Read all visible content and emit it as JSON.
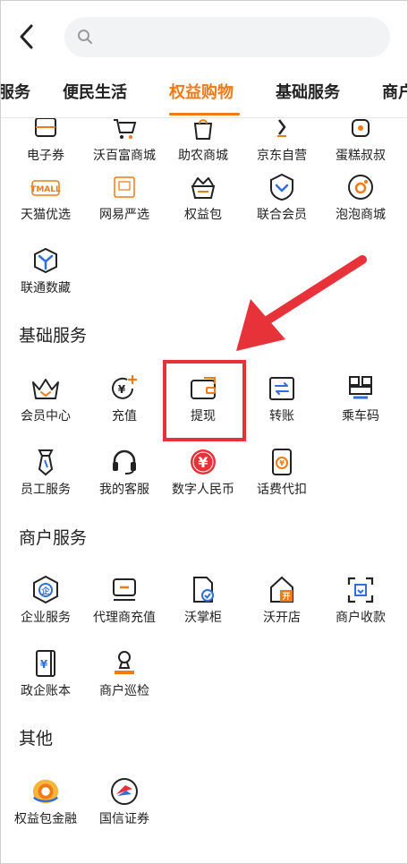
{
  "tabs": [
    {
      "label": "服务"
    },
    {
      "label": "便民生活"
    },
    {
      "label": "权益购物"
    },
    {
      "label": "基础服务"
    },
    {
      "label": "商户"
    }
  ],
  "search": {
    "placeholder": ""
  },
  "shopping": {
    "items": [
      {
        "label": "电子券",
        "icon": "coupon-icon"
      },
      {
        "label": "沃百富商城",
        "icon": "cart-icon"
      },
      {
        "label": "助农商城",
        "icon": "farm-bag-icon"
      },
      {
        "label": "京东自营",
        "icon": "jd-icon"
      },
      {
        "label": "蛋糕叔叔",
        "icon": "cake-icon"
      },
      {
        "label": "天猫优选",
        "icon": "tmall-icon"
      },
      {
        "label": "网易严选",
        "icon": "netease-icon"
      },
      {
        "label": "权益包",
        "icon": "crown-basket-icon"
      },
      {
        "label": "联合会员",
        "icon": "shield-chevron-icon"
      },
      {
        "label": "泡泡商城",
        "icon": "bubble-icon"
      },
      {
        "label": "联通数藏",
        "icon": "cube-icon"
      }
    ]
  },
  "basic": {
    "title": "基础服务",
    "items": [
      {
        "label": "会员中心",
        "icon": "crown-icon"
      },
      {
        "label": "充值",
        "icon": "recharge-icon"
      },
      {
        "label": "提现",
        "icon": "wallet-icon"
      },
      {
        "label": "转账",
        "icon": "transfer-icon"
      },
      {
        "label": "乘车码",
        "icon": "bus-code-icon"
      },
      {
        "label": "员工服务",
        "icon": "tie-icon"
      },
      {
        "label": "我的客服",
        "icon": "headset-icon"
      },
      {
        "label": "数字人民币",
        "icon": "ecny-icon"
      },
      {
        "label": "话费代扣",
        "icon": "phone-bill-icon"
      }
    ]
  },
  "merchant": {
    "title": "商户服务",
    "items": [
      {
        "label": "企业服务",
        "icon": "enterprise-icon"
      },
      {
        "label": "代理商充值",
        "icon": "agent-recharge-icon"
      },
      {
        "label": "沃掌柜",
        "icon": "manager-icon"
      },
      {
        "label": "沃开店",
        "icon": "open-store-icon"
      },
      {
        "label": "商户收款",
        "icon": "scan-collect-icon"
      },
      {
        "label": "政企账本",
        "icon": "ledger-icon"
      },
      {
        "label": "商户巡检",
        "icon": "inspect-icon"
      }
    ]
  },
  "other": {
    "title": "其他",
    "items": [
      {
        "label": "权益包金融",
        "icon": "finance-coin-icon"
      },
      {
        "label": "国信证券",
        "icon": "securities-icon"
      }
    ]
  },
  "colors": {
    "accent": "#f07a16",
    "highlight": "#e8323a",
    "icon_blue": "#2f6fdc"
  }
}
